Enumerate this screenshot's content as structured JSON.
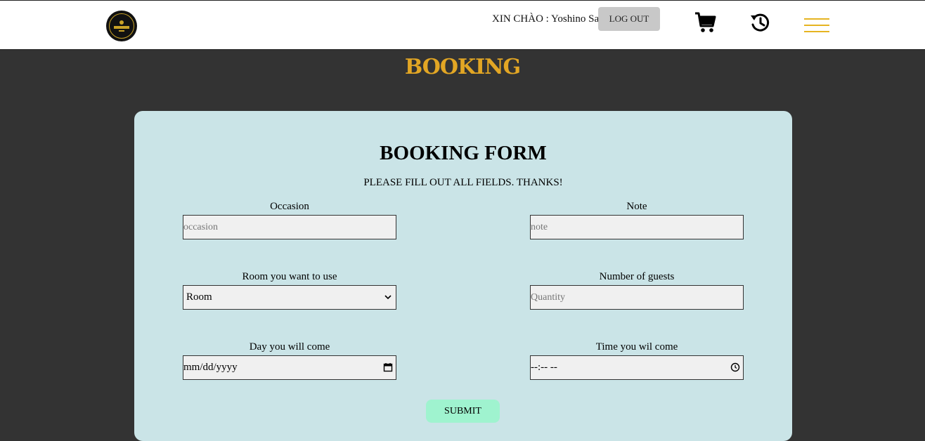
{
  "header": {
    "greeting": "XIN CHÀO : Yoshino Sae",
    "logout_label": "LOG OUT",
    "icons": [
      "logo",
      "cart-icon",
      "history-icon",
      "menu-icon"
    ],
    "menu_color": "#e6b422"
  },
  "page": {
    "title": "BOOKING",
    "title_color": "#e2a624",
    "background": "#333333"
  },
  "form": {
    "title": "BOOKING FORM",
    "subtitle": "PLEASE FILL OUT ALL FIELDS. THANKS!",
    "card_color": "#cae4e7",
    "fields": {
      "occasion": {
        "label": "Occasion",
        "placeholder": "occasion"
      },
      "note": {
        "label": "Note",
        "placeholder": "note"
      },
      "room": {
        "label": "Room you want to use",
        "value": "Room"
      },
      "guests": {
        "label": "Number of guests",
        "placeholder": "Quantity"
      },
      "day": {
        "label": "Day you will come",
        "value": "mm/dd/yyyy"
      },
      "time": {
        "label": "Time you wil come",
        "value": "--:-- --"
      }
    },
    "submit_label": "SUBMIT",
    "submit_color": "#9ff3cf"
  }
}
